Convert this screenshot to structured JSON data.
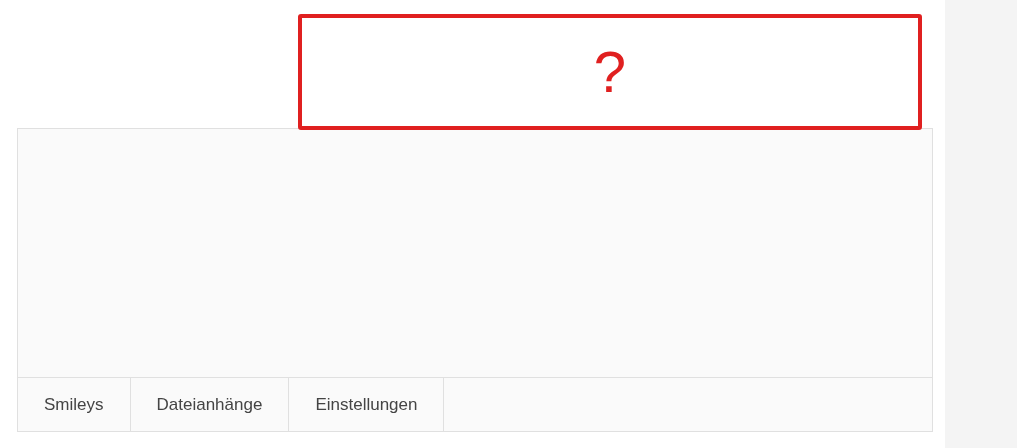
{
  "annotation": {
    "text": "?"
  },
  "editor_tabs": [
    {
      "label": "Smileys",
      "selected": false
    },
    {
      "label": "Dateianhänge",
      "selected": false
    },
    {
      "label": "Einstellungen",
      "selected": false
    }
  ]
}
